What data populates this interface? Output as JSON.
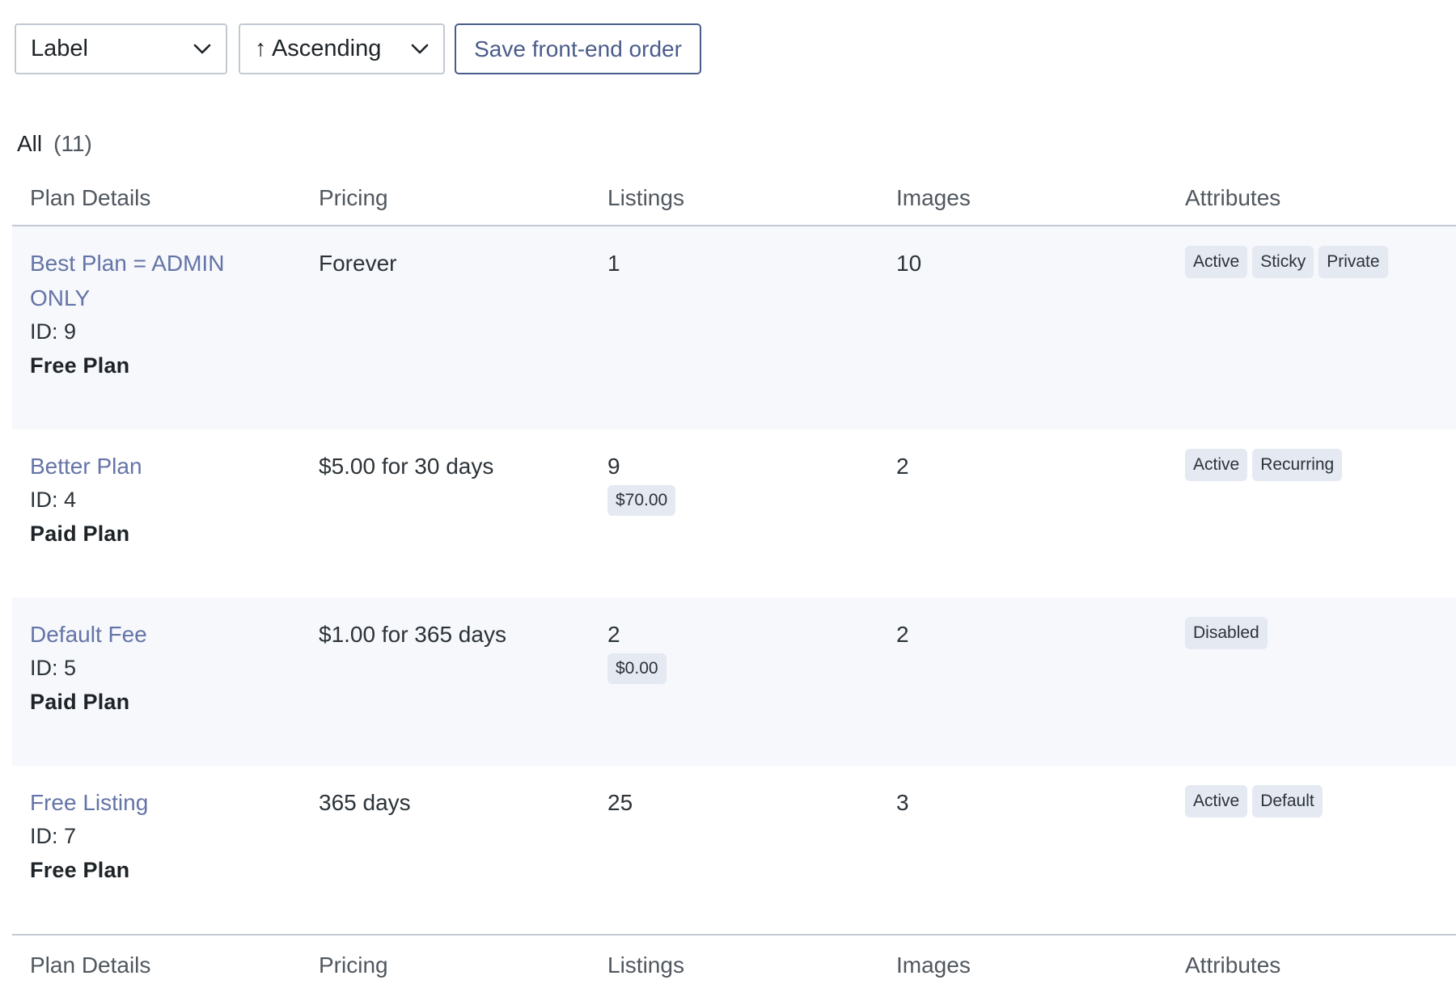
{
  "toolbar": {
    "sort_field": "Label",
    "sort_direction": "↑ Ascending",
    "save_label": "Save front-end order"
  },
  "filter": {
    "all_label": "All",
    "all_count": "(11)"
  },
  "table": {
    "columns": [
      "Plan Details",
      "Pricing",
      "Listings",
      "Images",
      "Attributes"
    ],
    "rows": [
      {
        "name": "Best Plan = ADMIN ONLY",
        "id": "ID: 9",
        "type": "Free Plan",
        "pricing": "Forever",
        "listings": "1",
        "listings_price": "",
        "images": "10",
        "attributes": [
          "Active",
          "Sticky",
          "Private"
        ]
      },
      {
        "name": "Better Plan",
        "id": "ID: 4",
        "type": "Paid Plan",
        "pricing": "$5.00 for 30 days",
        "listings": "9",
        "listings_price": "$70.00",
        "images": "2",
        "attributes": [
          "Active",
          "Recurring"
        ]
      },
      {
        "name": "Default Fee",
        "id": "ID: 5",
        "type": "Paid Plan",
        "pricing": "$1.00 for 365 days",
        "listings": "2",
        "listings_price": "$0.00",
        "images": "2",
        "attributes": [
          "Disabled"
        ]
      },
      {
        "name": "Free Listing",
        "id": "ID: 7",
        "type": "Free Plan",
        "pricing": "365 days",
        "listings": "25",
        "listings_price": "",
        "images": "3",
        "attributes": [
          "Active",
          "Default"
        ]
      }
    ]
  },
  "icons": {
    "dropdown": "chevron-down-icon"
  },
  "colors": {
    "link": "#6474a6",
    "button_border": "#4a5c8a",
    "row_shade": "#f6f8fc",
    "badge_bg": "#e4e9f2"
  }
}
